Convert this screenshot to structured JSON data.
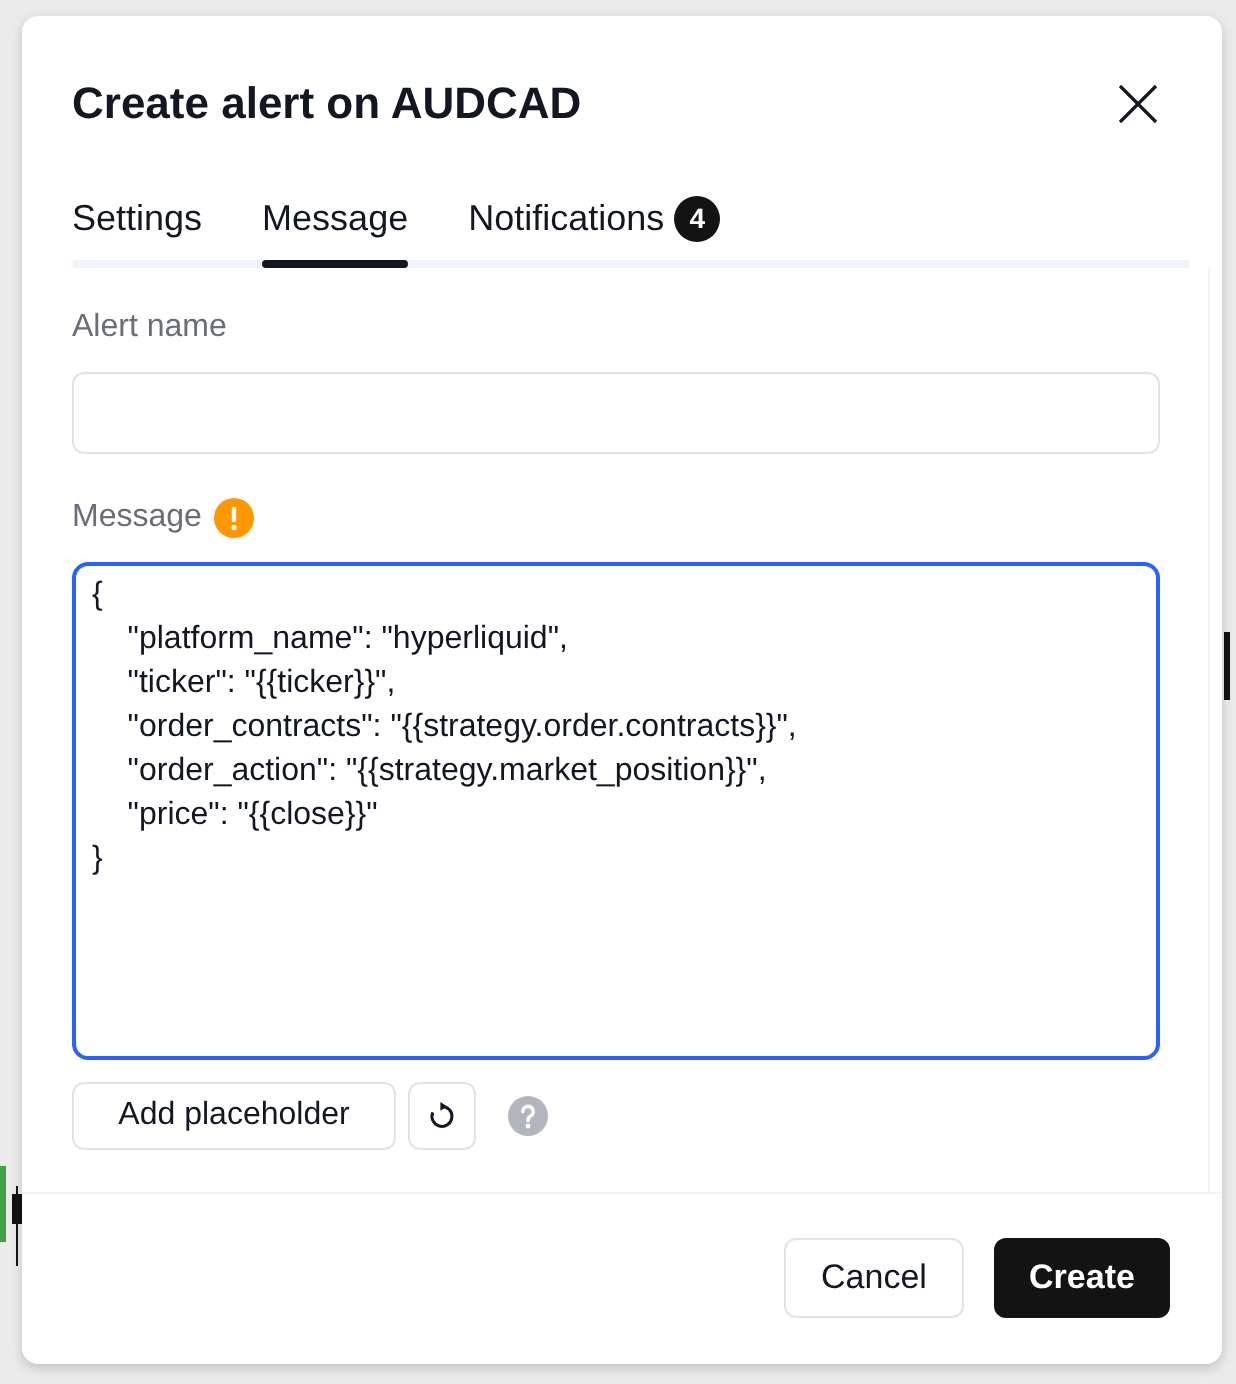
{
  "dialog": {
    "title": "Create alert on AUDCAD"
  },
  "tabs": [
    {
      "label": "Settings",
      "selected": false
    },
    {
      "label": "Message",
      "selected": true
    },
    {
      "label": "Notifications",
      "selected": false,
      "badge": "4"
    }
  ],
  "alert_name": {
    "label": "Alert name"
  },
  "message": {
    "label": "Message",
    "warning": true,
    "value": "{\n    \"platform_name\": \"hyperliquid\",\n    \"ticker\": \"{{ticker}}\",\n    \"order_contracts\": \"{{strategy.order.contracts}}\",\n    \"order_action\": \"{{strategy.market_position}}\",\n    \"price\": \"{{close}}\"\n}"
  },
  "message_toolbar": {
    "add_button": "Add placeholder"
  },
  "footer": {
    "buttons": [
      {
        "kind": "secondary",
        "label": "Cancel"
      },
      {
        "kind": "primary",
        "label": "Create"
      }
    ]
  }
}
